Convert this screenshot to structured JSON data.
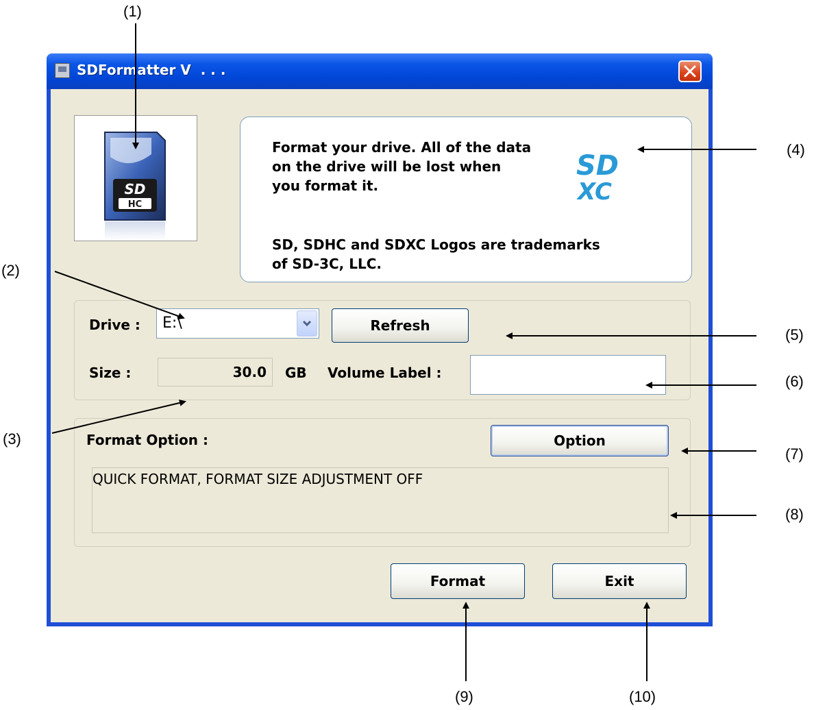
{
  "window": {
    "title": "SDFormatter V",
    "title_version_masked": " . . ."
  },
  "info_panel": {
    "message_line1": "Format your drive. All of the data",
    "message_line2": "on the drive will be lost when",
    "message_line3": "you format it.",
    "trademark_line1": "SD, SDHC and SDXC Logos are trademarks",
    "trademark_line2": "of SD-3C, LLC.",
    "logo_text_top": "SD",
    "logo_text_bottom": "XC"
  },
  "card_image": {
    "logo_text": "SD",
    "badge_text": "HC"
  },
  "drive_group": {
    "drive_label": "Drive :",
    "drive_value": "E:\\",
    "refresh_label": "Refresh",
    "size_label": "Size :",
    "size_value": "30.0",
    "size_unit": "GB",
    "volume_label": "Volume Label :",
    "volume_value": ""
  },
  "format_group": {
    "format_option_label": "Format Option :",
    "option_button": "Option",
    "option_summary": "QUICK FORMAT, FORMAT SIZE ADJUSTMENT OFF"
  },
  "footer": {
    "format_button": "Format",
    "exit_button": "Exit"
  },
  "callouts": [
    "(1)",
    "(2)",
    "(3)",
    "(4)",
    "(5)",
    "(6)",
    "(7)",
    "(8)",
    "(9)",
    "(10)"
  ],
  "colors": {
    "titlebar": "#0a55e6",
    "client_bg": "#ece9d8",
    "close_button": "#d9411b",
    "sdxc_logo": "#2a9ad6"
  },
  "icons": [
    "app-icon",
    "close-icon",
    "sd-card-icon",
    "sdxc-logo",
    "chevron-down-icon"
  ]
}
